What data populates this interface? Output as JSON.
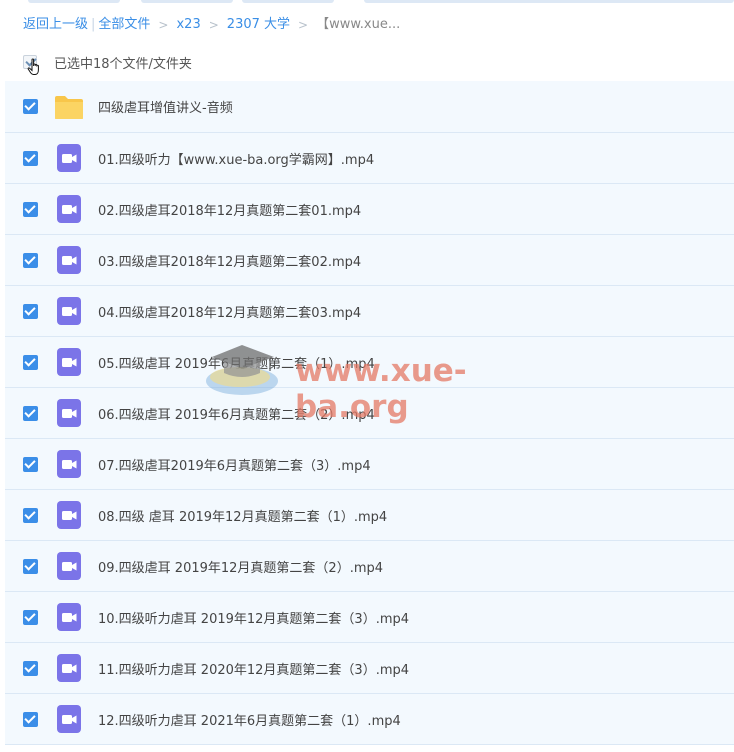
{
  "breadcrumb": {
    "back": "返回上一级",
    "all_files": "全部文件",
    "level1": "x23",
    "level2": "2307 大学",
    "current": "【www.xue..."
  },
  "selection": {
    "status": "已选中18个文件/文件夹"
  },
  "files": [
    {
      "name": "四级虐耳增值讲义-音频",
      "type": "folder-icon"
    },
    {
      "name": "01.四级听力【www.xue-ba.org学霸网】.mp4",
      "type": "video-icon"
    },
    {
      "name": "02.四级虐耳2018年12月真题第二套01.mp4",
      "type": "video-icon"
    },
    {
      "name": "03.四级虐耳2018年12月真题第二套02.mp4",
      "type": "video-icon"
    },
    {
      "name": "04.四级虐耳2018年12月真题第二套03.mp4",
      "type": "video-icon"
    },
    {
      "name": "05.四级虐耳 2019年6月真题第二套（1）.mp4",
      "type": "video-icon"
    },
    {
      "name": "06.四级虐耳 2019年6月真题第二套（2）.mp4",
      "type": "video-icon"
    },
    {
      "name": "07.四级虐耳2019年6月真题第二套（3）.mp4",
      "type": "video-icon"
    },
    {
      "name": "08.四级 虐耳 2019年12月真题第二套（1）.mp4",
      "type": "video-icon"
    },
    {
      "name": "09.四级虐耳 2019年12月真题第二套（2）.mp4",
      "type": "video-icon"
    },
    {
      "name": "10.四级听力虐耳 2019年12月真题第二套（3）.mp4",
      "type": "video-icon"
    },
    {
      "name": "11.四级听力虐耳 2020年12月真题第二套（3）.mp4",
      "type": "video-icon"
    },
    {
      "name": "12.四级听力虐耳 2021年6月真题第二套（1）.mp4",
      "type": "video-icon"
    }
  ],
  "watermark": {
    "text": "www.xue-ba.org"
  },
  "colors": {
    "link": "#3a8ee6",
    "checkbox": "#3b8ee8",
    "row_bg": "#f3f9fe",
    "folder": "#f8c64a",
    "video": "#7b74e8"
  }
}
